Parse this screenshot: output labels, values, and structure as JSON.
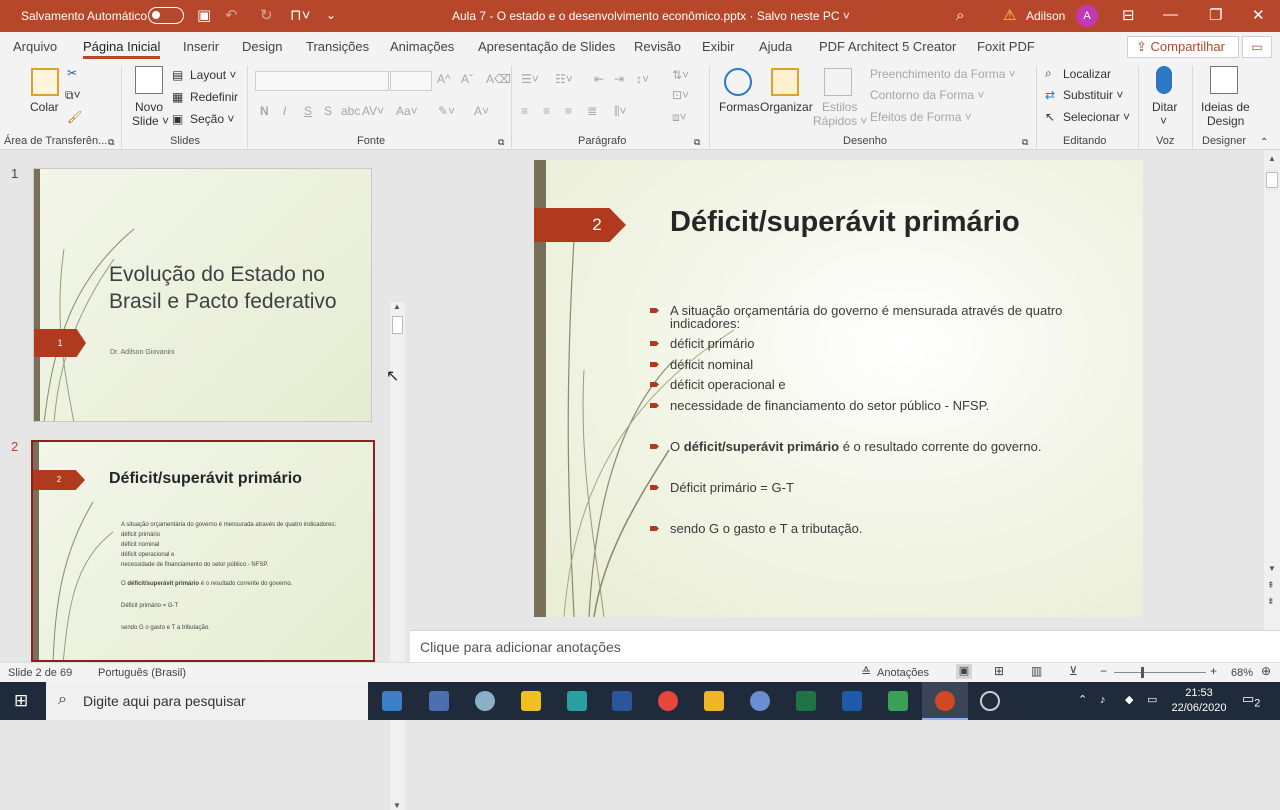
{
  "titlebar": {
    "autosave_label": "Salvamento Automático",
    "doc_title": "Aula 7 - O estado e o desenvolvimento econômico.pptx  ·  Salvo neste PC  ˅",
    "user_name": "Adilson",
    "avatar_initial": "A"
  },
  "tabs": [
    "Arquivo",
    "Página Inicial",
    "Inserir",
    "Design",
    "Transições",
    "Animações",
    "Apresentação de Slides",
    "Revisão",
    "Exibir",
    "Ajuda",
    "PDF Architect 5 Creator",
    "Foxit PDF"
  ],
  "share_label": "Compartilhar",
  "ribbon": {
    "colar": "Colar",
    "novo_slide": "Novo",
    "slide": "Slide ˅",
    "layout": "Layout ˅",
    "redefinir": "Redefinir",
    "secao": "Seção ˅",
    "formas": "Formas",
    "organizar": "Organizar",
    "estilos": "Estilos",
    "rapidos": "Rápidos ˅",
    "preenchimento": "Preenchimento da Forma ˅",
    "contorno": "Contorno da Forma ˅",
    "efeitos": "Efeitos de Forma ˅",
    "localizar": "Localizar",
    "substituir": "Substituir ˅",
    "selecionar": "Selecionar ˅",
    "ditar": "Ditar",
    "ideias": "Ideias de",
    "design_label": "Design",
    "groups": {
      "clipboard": "Área de Transferên...",
      "slides": "Slides",
      "fonte": "Fonte",
      "paragrafo": "Parágrafo",
      "desenho": "Desenho",
      "editando": "Editando",
      "voz": "Voz",
      "designer": "Designer"
    }
  },
  "thumbs": {
    "t1_num": "1",
    "t1_title": "Evolução do Estado no Brasil e Pacto federativo",
    "t1_sub": "Dr. Adilson Giovanini",
    "t1_flag": "1",
    "t2_num": "2",
    "t2_title": "Déficit/superávit primário",
    "t2_flag": "2"
  },
  "slide": {
    "number": "2",
    "title": "Déficit/superávit primário",
    "bullets": [
      "A situação orçamentária do governo é mensurada através de quatro indicadores:",
      "déficit primário",
      "déficit nominal",
      "déficit operacional e",
      "necessidade de financiamento do setor público - NFSP.",
      "O",
      "déficit/superávit primário",
      "é o resultado corrente do governo.",
      "Déficit primário = G-T",
      "sendo G o gasto e T a tributação."
    ]
  },
  "notes_placeholder": "Clique para adicionar anotações",
  "status": {
    "slide_count": "Slide 2 de 69",
    "language": "Português (Brasil)",
    "notes_btn": "Anotações",
    "zoom": "68%"
  },
  "taskbar": {
    "search_placeholder": "Digite aqui para pesquisar",
    "time": "21:53",
    "date": "22/06/2020",
    "notif": "2"
  }
}
